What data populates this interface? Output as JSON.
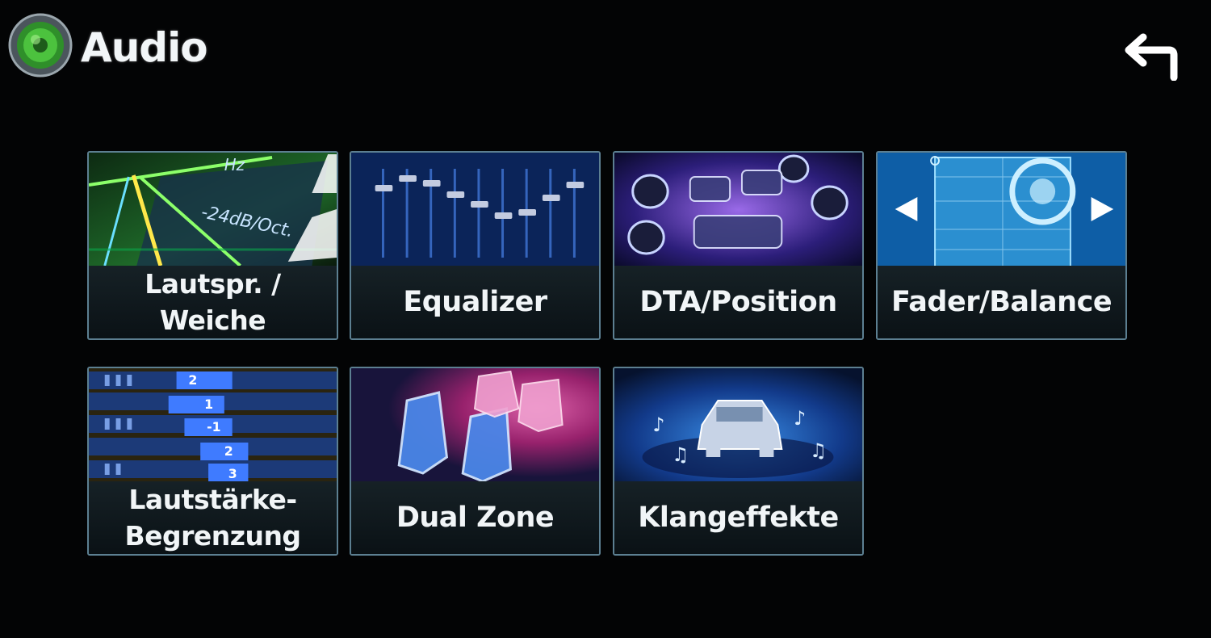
{
  "header": {
    "title": "Audio",
    "app_icon": "speaker-icon",
    "back_icon": "back-arrow-icon"
  },
  "tiles": [
    {
      "label": "Lautspr. /\nWeiche",
      "icon": "crossover-graph-icon",
      "accent": "#2aa63a"
    },
    {
      "label": "Equalizer",
      "icon": "equalizer-sliders-icon",
      "accent": "#1f4fb0"
    },
    {
      "label": "DTA/Position",
      "icon": "car-speakers-layout-icon",
      "accent": "#6a3fc2"
    },
    {
      "label": "Fader/Balance",
      "icon": "fader-balance-icon",
      "accent": "#1f7fc0"
    },
    {
      "label": "Lautstärke-\nBegrenzung",
      "icon": "volume-limit-icon",
      "accent": "#8a6a20"
    },
    {
      "label": "Dual Zone",
      "icon": "dual-zone-seats-icon",
      "accent": "#c0306a"
    },
    {
      "label": "Klangeffekte",
      "icon": "sound-effects-car-icon",
      "accent": "#1f6fc0"
    }
  ]
}
